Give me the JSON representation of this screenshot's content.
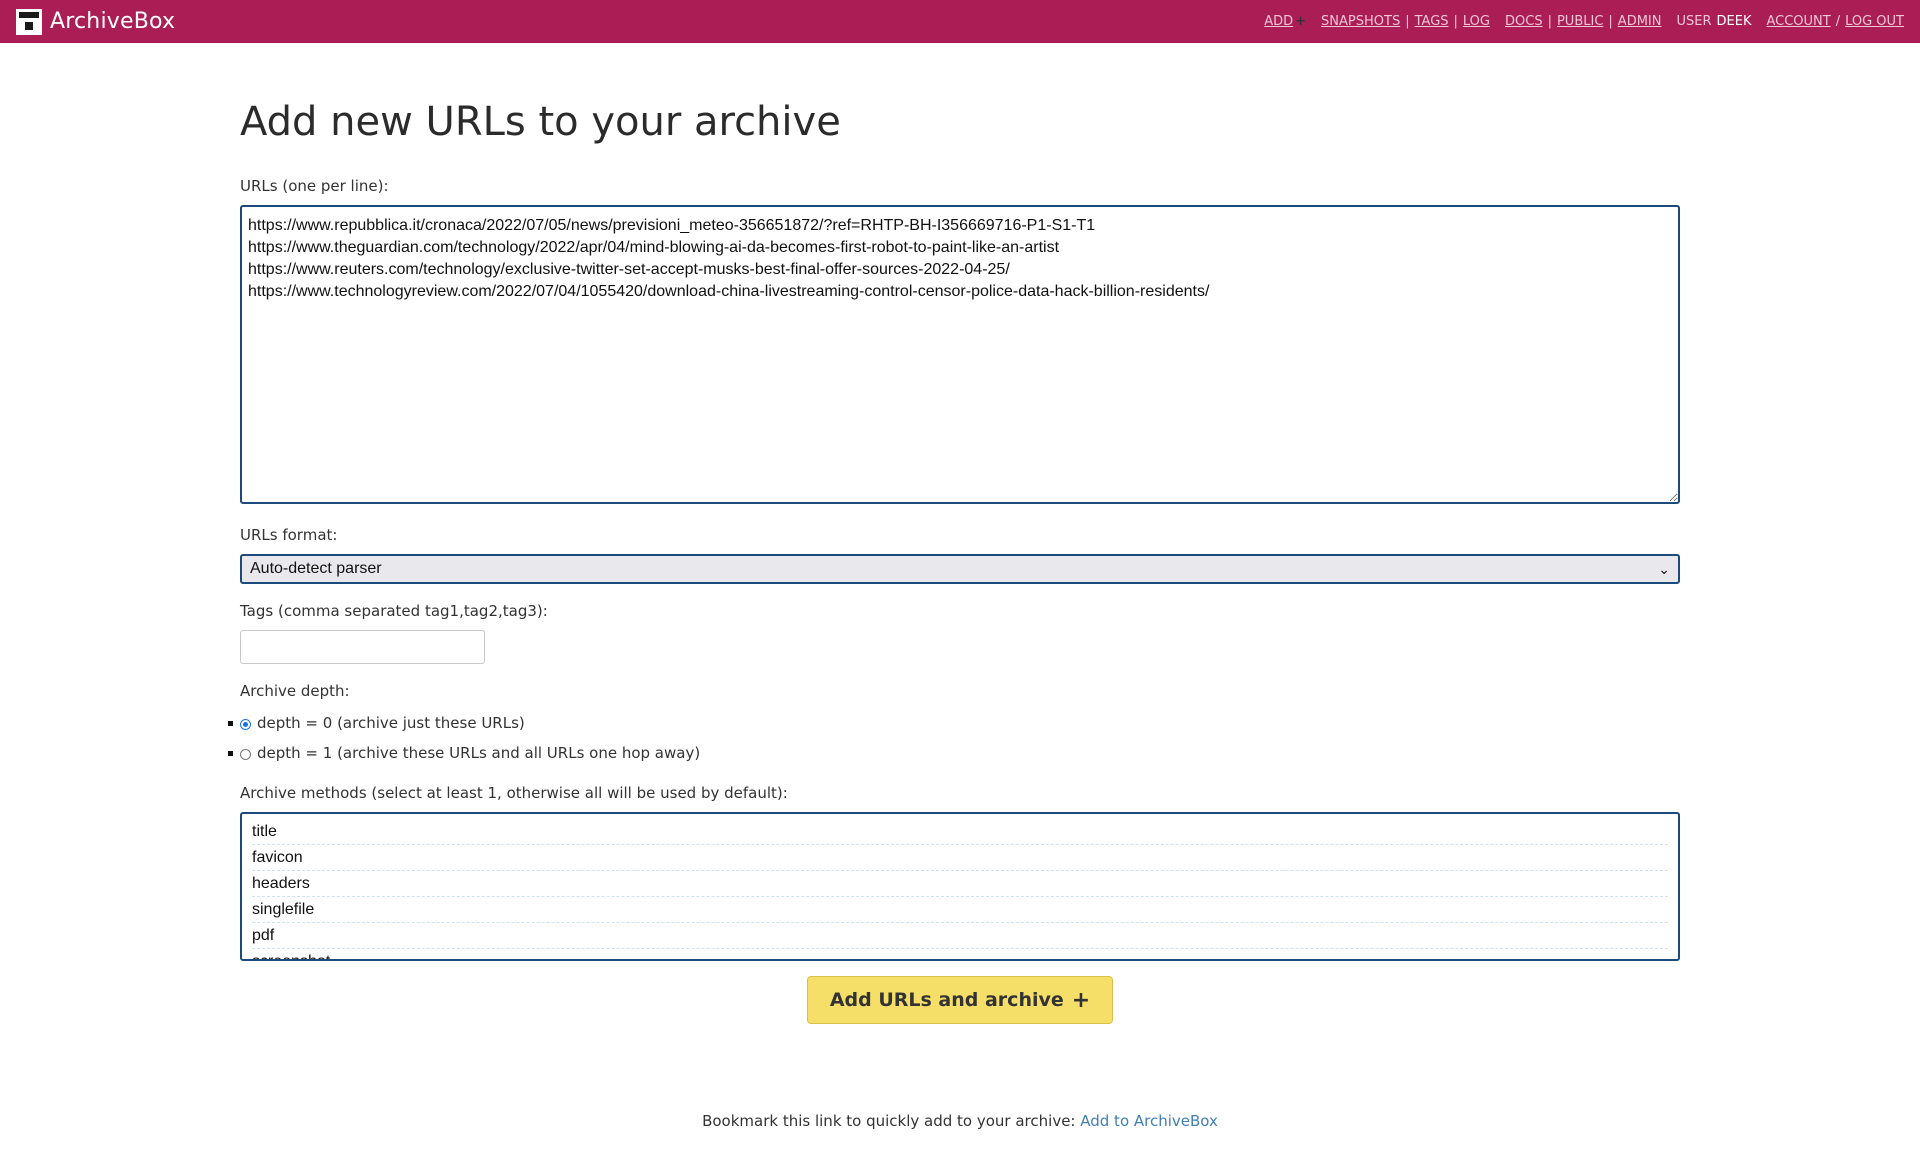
{
  "header": {
    "brand": "ArchiveBox",
    "nav": {
      "add": "ADD",
      "snapshots": "SNAPSHOTS",
      "tags": "TAGS",
      "log": "LOG",
      "docs": "DOCS",
      "public": "PUBLIC",
      "admin": "ADMIN",
      "user_label": "USER",
      "user_name": "DEEK",
      "account": "ACCOUNT",
      "logout": "LOG OUT"
    }
  },
  "page": {
    "title": "Add new URLs to your archive"
  },
  "form": {
    "urls_label": "URLs (one per line):",
    "urls_value": "https://www.repubblica.it/cronaca/2022/07/05/news/previsioni_meteo-356651872/?ref=RHTP-BH-I356669716-P1-S1-T1\nhttps://www.theguardian.com/technology/2022/apr/04/mind-blowing-ai-da-becomes-first-robot-to-paint-like-an-artist\nhttps://www.reuters.com/technology/exclusive-twitter-set-accept-musks-best-final-offer-sources-2022-04-25/\nhttps://www.technologyreview.com/2022/07/04/1055420/download-china-livestreaming-control-censor-police-data-hack-billion-residents/",
    "format_label": "URLs format:",
    "format_value": "Auto-detect parser",
    "tags_label": "Tags (comma separated tag1,tag2,tag3):",
    "tags_value": "",
    "depth_label": "Archive depth:",
    "depth_options": [
      {
        "label": "depth = 0 (archive just these URLs)",
        "selected": true
      },
      {
        "label": "depth = 1 (archive these URLs and all URLs one hop away)",
        "selected": false
      }
    ],
    "methods_label": "Archive methods (select at least 1, otherwise all will be used by default):",
    "methods": [
      "title",
      "favicon",
      "headers",
      "singlefile",
      "pdf",
      "screenshot"
    ],
    "submit_label": "Add URLs and archive"
  },
  "footer": {
    "text": "Bookmark this link to quickly add to your archive: ",
    "link_text": "Add to ArchiveBox"
  },
  "colors": {
    "header_bg": "#aa1e55",
    "button_bg": "#f5df68",
    "border_focus": "#1d4a7a",
    "link": "#3f7fb6"
  }
}
